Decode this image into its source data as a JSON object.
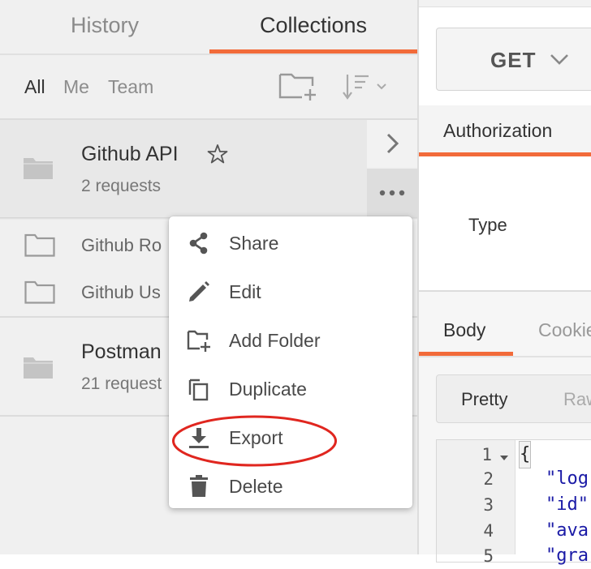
{
  "sidebar": {
    "tabs": {
      "history": "History",
      "collections": "Collections"
    },
    "filters": {
      "all": "All",
      "me": "Me",
      "team": "Team"
    },
    "collections": [
      {
        "name": "Github API",
        "count": "2 requests"
      },
      {
        "name": "Postman",
        "count": "21 request"
      }
    ],
    "folders": [
      "Github Ro",
      "Github Us"
    ]
  },
  "context_menu": {
    "items": [
      {
        "label": "Share",
        "icon": "share-icon"
      },
      {
        "label": "Edit",
        "icon": "pencil-icon"
      },
      {
        "label": "Add Folder",
        "icon": "add-folder-icon"
      },
      {
        "label": "Duplicate",
        "icon": "duplicate-icon"
      },
      {
        "label": "Export",
        "icon": "download-icon"
      },
      {
        "label": "Delete",
        "icon": "trash-icon"
      }
    ],
    "highlighted": "Export"
  },
  "request": {
    "method": "GET",
    "tab_authorization": "Authorization",
    "type_label": "Type"
  },
  "response": {
    "tab_body": "Body",
    "tab_cookies": "Cookie",
    "view_pretty": "Pretty",
    "view_raw": "Raw",
    "line_numbers": [
      "1",
      "2",
      "3",
      "4",
      "5"
    ],
    "code_lines": [
      "{",
      "\"log",
      "\"id\"",
      "\"ava",
      "\"gra"
    ]
  },
  "colors": {
    "accent": "#f26b3a",
    "highlight_ring": "#e0261f"
  }
}
